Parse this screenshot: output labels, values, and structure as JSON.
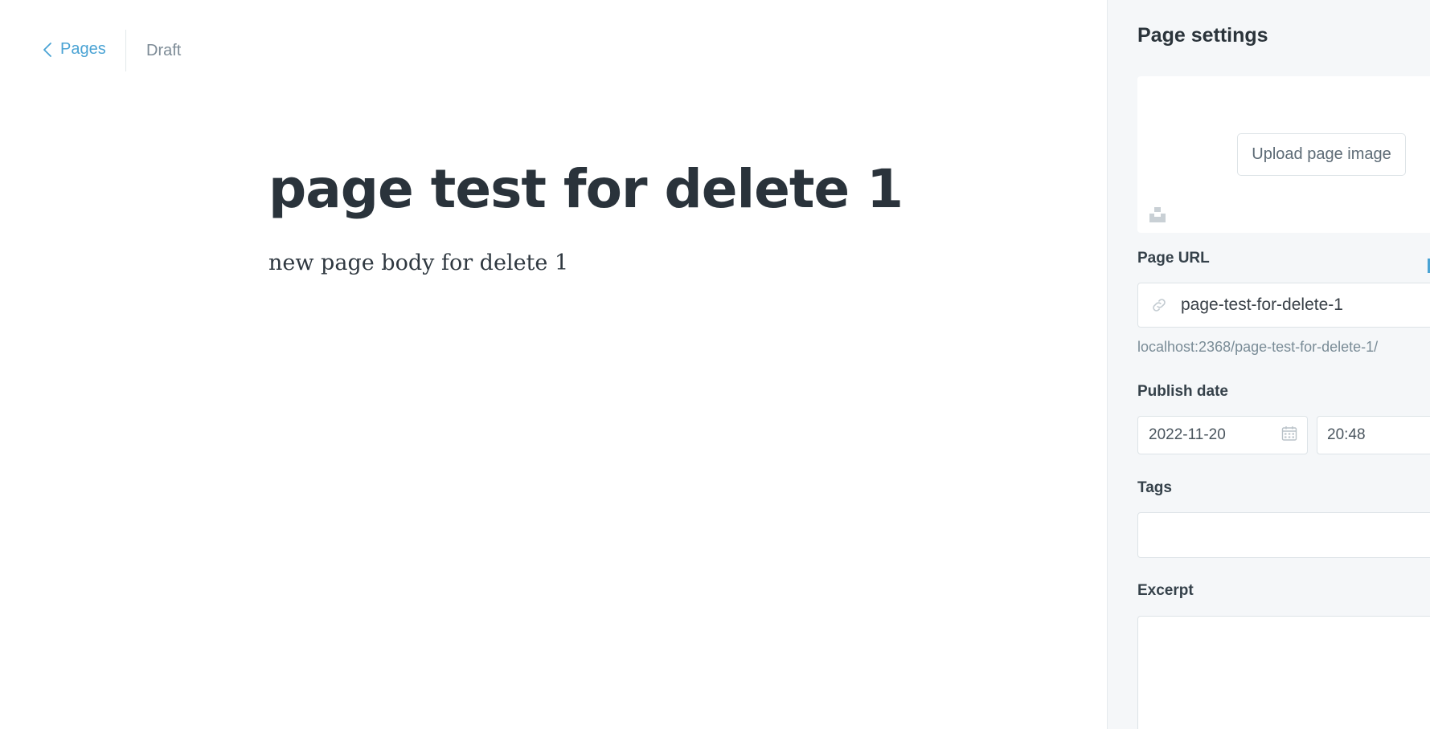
{
  "nav": {
    "back_label": "Pages",
    "status": "Draft"
  },
  "content": {
    "title": "page test for delete 1",
    "body": "new page body for delete 1"
  },
  "settings": {
    "title": "Page settings",
    "upload_label": "Upload page image",
    "url_label": "Page URL",
    "url_value": "page-test-for-delete-1",
    "url_preview": "localhost:2368/page-test-for-delete-1/",
    "publish_label": "Publish date",
    "publish_date": "2022-11-20",
    "publish_time": "20:48",
    "tags_label": "Tags",
    "tags_value": "",
    "excerpt_label": "Excerpt",
    "excerpt_value": ""
  },
  "colors": {
    "accent": "#4aa3d4",
    "sidebar_bg": "#f5f7f9",
    "title_text": "#2a333b"
  }
}
